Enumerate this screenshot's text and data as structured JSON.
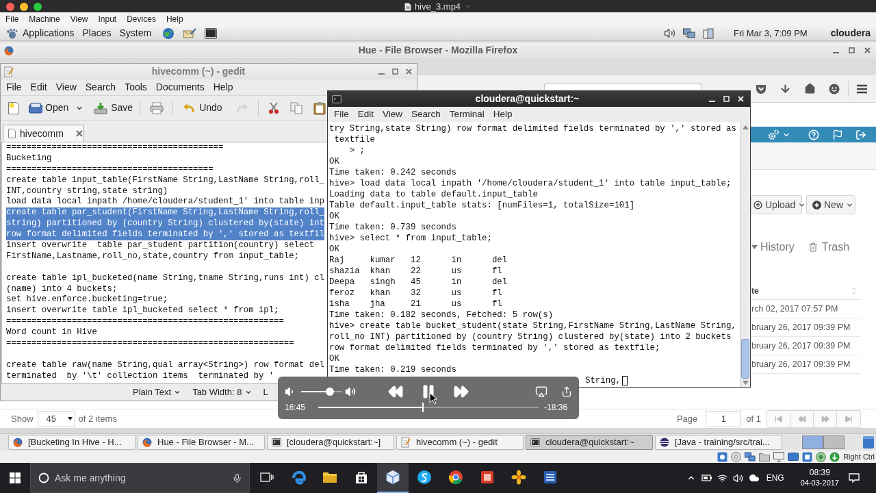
{
  "player_bar": {
    "title": "hive_3.mp4"
  },
  "vm_menu": [
    "File",
    "Machine",
    "View",
    "Input",
    "Devices",
    "Help"
  ],
  "top_panel": {
    "menus": [
      "Applications",
      "Places",
      "System"
    ],
    "clock": "Fri Mar 3, 7:09 PM",
    "user": "cloudera"
  },
  "firefox": {
    "title": "Hue - File Browser - Mozilla Firefox",
    "upload": "Upload",
    "new": "New",
    "history": "History",
    "trash": "Trash",
    "table": {
      "columns": [
        "te"
      ],
      "rows": [
        "rch 02, 2017 07:57 PM",
        "bruary 26, 2017 09:39 PM",
        "bruary 26, 2017 09:39 PM",
        "bruary 26, 2017 09:39 PM"
      ]
    },
    "footer": {
      "show_label": "Show",
      "page_size": "45",
      "items_label": "of 2 items",
      "page_label": "Page",
      "page": "1",
      "pages_label": "of 1"
    }
  },
  "gedit": {
    "title": "hivecomm (~) - gedit",
    "menu": [
      "File",
      "Edit",
      "View",
      "Search",
      "Tools",
      "Documents",
      "Help"
    ],
    "toolbar": {
      "open": "Open",
      "save": "Save",
      "undo": "Undo",
      "redo": {
        "disabled": true
      }
    },
    "tabs": [
      {
        "label": "hivecomm",
        "selected": true
      }
    ],
    "blocks": [
      {
        "lines": [
          {
            "text": "===========================================",
            "selected": false
          },
          {
            "text": "Bucketing",
            "selected": false
          },
          {
            "text": "=========================================",
            "selected": false
          },
          {
            "text": "create table input_table(FirstName String,LastName String,roll_",
            "selected": false
          },
          {
            "text": "INT,country string,state string)",
            "selected": false
          },
          {
            "text": "load data local inpath /home/cloudera/student_1' into table inp",
            "selected": false
          },
          {
            "text": "create table par_student(FirstName String,LastName String,roll_",
            "selected": true
          },
          {
            "text": "string) partitioned by (country String) clustered by(state) int",
            "selected": true
          },
          {
            "text": "row format delimited fields terminated by ',' stored as textfil",
            "selected": true
          },
          {
            "text": "insert overwrite  table par_student partition(country) select",
            "selected": false
          },
          {
            "text": "FirstName,Lastname,roll_no,state,country from input_table;",
            "selected": false
          }
        ]
      },
      {
        "lines": [
          {
            "text": "create table ipl_bucketed(name String,tname String,runs int) cl",
            "selected": false
          },
          {
            "text": "(name) into 4 buckets;",
            "selected": false
          },
          {
            "text": "set hive.enforce.bucketing=true;",
            "selected": false
          },
          {
            "text": "insert overwrite table ipl_bucketed select * from ipl;",
            "selected": false
          },
          {
            "text": "=======================================================",
            "selected": false
          },
          {
            "text": "Word count in Hive",
            "selected": false
          },
          {
            "text": "=========================================================",
            "selected": false
          }
        ]
      },
      {
        "lines": [
          {
            "text": "create table raw(name String,qual array<String>) row format del",
            "selected": false
          },
          {
            "text": "terminated  by '\\t' collection items  terminated by '",
            "selected": false
          }
        ]
      }
    ],
    "status": {
      "language": "Plain Text",
      "tab_width": "Tab Width: 8",
      "position": "L"
    }
  },
  "terminal": {
    "title": "cloudera@quickstart:~",
    "menu": [
      "File",
      "Edit",
      "View",
      "Search",
      "Terminal",
      "Help"
    ],
    "lines": [
      "try String,state String) row format delimited fields terminated by ',' stored as",
      " textfile",
      "    > ;",
      "OK",
      "Time taken: 0.242 seconds",
      "hive> load data local inpath '/home/cloudera/student_1' into table input_table;",
      "Loading data to table default.input_table",
      "Table default.input_table stats: [numFiles=1, totalSize=101]",
      "OK",
      "Time taken: 0.739 seconds",
      "hive> select * from input_table;",
      "OK",
      "Raj     kumar   12      in      del",
      "shazia  khan    22      us      fl",
      "Deepa   singh   45      in      del",
      "feroz   khan    32      us      fl",
      "isha    jha     21      us      fl",
      "Time taken: 0.182 seconds, Fetched: 5 row(s)",
      "hive> create table bucket_student(state String,FirstName String,LastName String,",
      "roll_no INT) partitioned by (country String) clustered by(state) into 2 buckets",
      "row format delimited fields terminated by ',' stored as textfile;",
      "OK",
      "Time taken: 0.219 seconds"
    ],
    "prompt_tail": "String,"
  },
  "player_controls": {
    "volume": {
      "level": 0.7
    },
    "playing": true,
    "elapsed": "16:45",
    "progress": {
      "level": 0.475
    },
    "remaining": "-18:36"
  },
  "task_panel": {
    "tasks": [
      {
        "label": "[Bucketing In Hive - H...",
        "kind": "browser",
        "selected": false
      },
      {
        "label": "Hue - File Browser - M...",
        "kind": "browser",
        "selected": false
      },
      {
        "label": "[cloudera@quickstart:~]",
        "kind": "terminal",
        "selected": false
      },
      {
        "label": "hivecomm (~) - gedit",
        "kind": "editor",
        "selected": false
      },
      {
        "label": "cloudera@quickstart:~",
        "kind": "terminal",
        "selected": true
      },
      {
        "label": "[Java - training/src/trai...",
        "kind": "ide",
        "selected": false
      }
    ],
    "workspaces": [
      {
        "selected": true
      },
      {
        "selected": false
      }
    ]
  },
  "vm_status": {
    "host_key": "Right Ctrl"
  },
  "win_taskbar": {
    "search_placeholder": "Ask me anything",
    "apps": [
      {
        "kind": "task_view",
        "selected": false
      },
      {
        "kind": "browser_e",
        "selected": false
      },
      {
        "kind": "folder",
        "selected": false
      },
      {
        "kind": "bag",
        "selected": false
      },
      {
        "kind": "cube",
        "selected": true
      },
      {
        "kind": "chat",
        "selected": false
      },
      {
        "kind": "ring",
        "selected": false
      },
      {
        "kind": "pdf",
        "selected": false
      },
      {
        "kind": "flower",
        "selected": false
      },
      {
        "kind": "document",
        "selected": false
      }
    ],
    "language": "ENG",
    "time": "08:39",
    "date": "04-03-2017"
  }
}
